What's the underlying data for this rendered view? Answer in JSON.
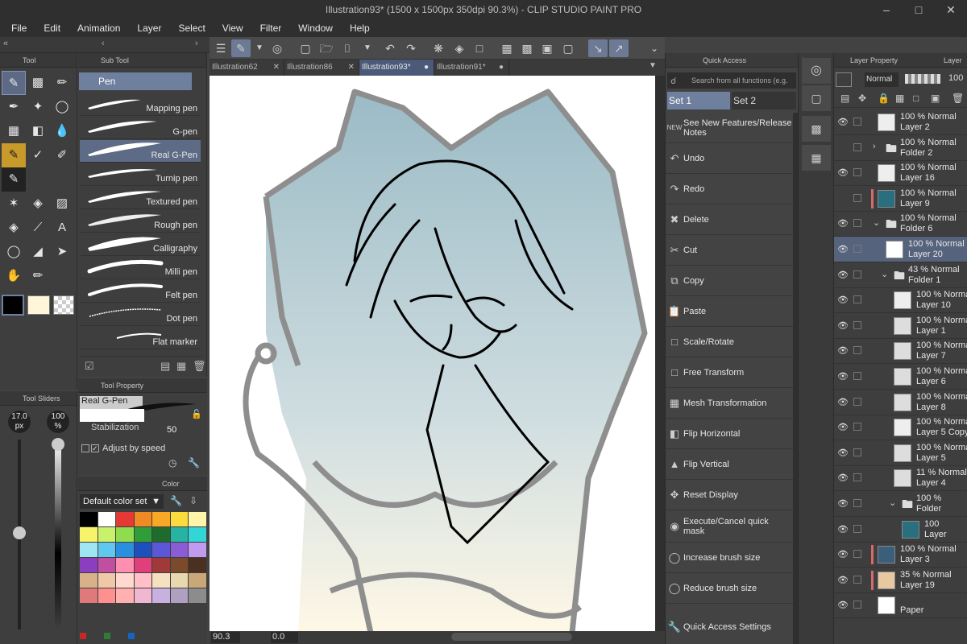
{
  "window": {
    "title": "Illustration93* (1500 x 1500px 350dpi 90.3%) - CLIP STUDIO PAINT PRO"
  },
  "menu": [
    "File",
    "Edit",
    "Animation",
    "Layer",
    "Select",
    "View",
    "Filter",
    "Window",
    "Help"
  ],
  "tool_panel": {
    "title": "Tool"
  },
  "sub_tool": {
    "title": "Sub Tool",
    "group": "Pen",
    "brushes": [
      "Mapping pen",
      "G-pen",
      "Real G-Pen",
      "Turnip pen",
      "Textured pen",
      "Rough pen",
      "Calligraphy",
      "Milli pen",
      "Felt pen",
      "Dot pen",
      "Flat marker"
    ]
  },
  "tool_property": {
    "title": "Tool Property",
    "brush_name": "Real G-Pen",
    "stabilization_label": "Stabilization",
    "stabilization_value": "50",
    "adjust_label": "Adjust by speed"
  },
  "tool_sliders": {
    "title": "Tool Sliders",
    "size": "17.0",
    "size_unit": "px",
    "opacity": "100",
    "opacity_unit": "%"
  },
  "color_panel": {
    "title": "Color",
    "set_name": "Default color set",
    "swatches": [
      "#000000",
      "#ffffff",
      "#e53935",
      "#f08a24",
      "#f9a825",
      "#fcdb3c",
      "#fff4a8",
      "#f7f36a",
      "#c8f26b",
      "#8fdc4f",
      "#2f9e3a",
      "#1f6b2c",
      "#27b3a3",
      "#33d6d6",
      "#9fe6f5",
      "#5fc7f0",
      "#2b8fe0",
      "#1e4fbf",
      "#5b57d6",
      "#8a5cd6",
      "#c19bf0",
      "#8b3ebf",
      "#c04fa0",
      "#ff8fb0",
      "#e0407a",
      "#a03a3a",
      "#7a4a2a",
      "#4a3020",
      "#d8b08a",
      "#f0c8a8",
      "#ffd8d0",
      "#ffc0c8",
      "#f5e0c0",
      "#e8d8b0",
      "#c8a878",
      "#e07a7a",
      "#ff9090",
      "#ffb0b0",
      "#f0b8d0",
      "#c8b0e0",
      "#b0a0c0",
      "#8c8c8c"
    ]
  },
  "tabs": [
    "Illustration62",
    "Illustration86",
    "Illustration93*",
    "Illustration91*"
  ],
  "status": {
    "zoom": "90.3",
    "angle": "0.0"
  },
  "quick_access": {
    "title": "Quick Access",
    "search_placeholder": "Search from all functions (e.g.",
    "set1": "Set 1",
    "set2": "Set 2",
    "items": [
      "See New Features/Release Notes",
      "Undo",
      "Redo",
      "Delete",
      "Cut",
      "Copy",
      "Paste",
      "Scale/Rotate",
      "Free Transform",
      "Mesh Transformation",
      "Flip Horizontal",
      "Flip Vertical",
      "Reset Display",
      "Execute/Cancel quick mask",
      "Increase brush size",
      "Reduce brush size",
      "Quick Access Settings"
    ]
  },
  "layer_panel": {
    "tab1": "Layer Property",
    "tab2": "Layer",
    "blend_mode": "Normal",
    "opacity": "100",
    "layers": [
      {
        "line1": "100 % Normal",
        "line2": "Layer 2"
      },
      {
        "line1": "100 % Normal",
        "line2": "Folder 2"
      },
      {
        "line1": "100 % Normal",
        "line2": "Layer 16"
      },
      {
        "line1": "100 % Normal",
        "line2": "Layer 9"
      },
      {
        "line1": "100 % Normal",
        "line2": "Folder 6"
      },
      {
        "line1": "100 % Normal",
        "line2": "Layer 20"
      },
      {
        "line1": "43 % Normal",
        "line2": "Folder 1"
      },
      {
        "line1": "100 % Normal",
        "line2": "Layer 10"
      },
      {
        "line1": "100 % Normal",
        "line2": "Layer 1"
      },
      {
        "line1": "100 % Normal",
        "line2": "Layer 7"
      },
      {
        "line1": "100 % Normal",
        "line2": "Layer 6"
      },
      {
        "line1": "100 % Normal",
        "line2": "Layer 8"
      },
      {
        "line1": "100 % Normal",
        "line2": "Layer 5 Copy"
      },
      {
        "line1": "100 % Normal",
        "line2": "Layer 5"
      },
      {
        "line1": "11 % Normal",
        "line2": "Layer 4"
      },
      {
        "line1": "100 %",
        "line2": "Folder"
      },
      {
        "line1": "100",
        "line2": "Layer"
      },
      {
        "line1": "100 % Normal",
        "line2": "Layer 3"
      },
      {
        "line1": "35 % Normal",
        "line2": "Layer 19"
      },
      {
        "line1": "",
        "line2": "Paper"
      }
    ]
  }
}
